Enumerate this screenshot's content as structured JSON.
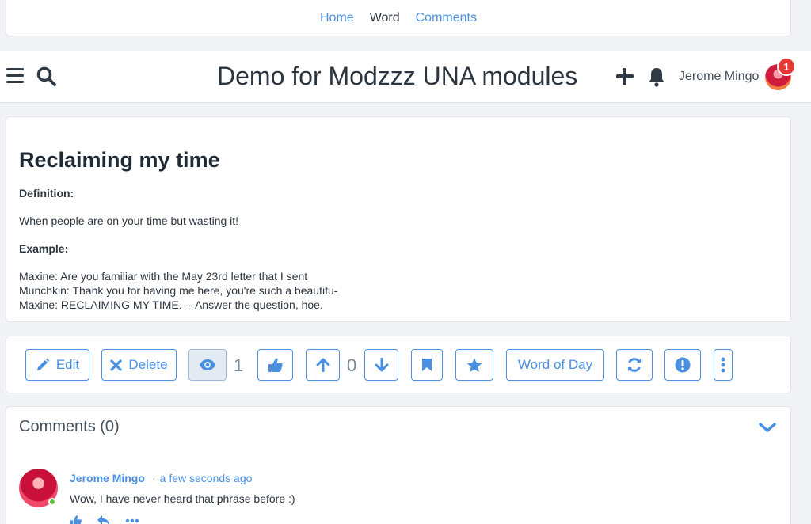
{
  "top_nav": {
    "items": [
      "Home",
      "Word",
      "Comments"
    ]
  },
  "header": {
    "site_title": "Demo for Modzzz UNA modules",
    "user_name": "Jerome Mingo",
    "notification_count": "1"
  },
  "word": {
    "title": "Reclaiming my time",
    "definition_label": "Definition:",
    "definition": "When people are on your time but wasting it!",
    "example_label": "Example:",
    "example_lines": [
      "Maxine: Are you familiar with the May 23rd letter that I sent",
      "Munchkin: Thank you for having me here, you're such a beautifu-",
      "Maxine: RECLAIMING MY TIME. -- Answer the question, hoe."
    ]
  },
  "actions": {
    "edit_label": "Edit",
    "delete_label": "Delete",
    "views_count": "1",
    "votes_count": "0",
    "word_of_day_label": "Word of Day"
  },
  "comments": {
    "title": "Comments (0)",
    "items": [
      {
        "author": "Jerome Mingo",
        "time": "a few seconds ago",
        "text": "Wow, I have never heard that phrase before :)"
      }
    ]
  },
  "colors": {
    "accent": "#4a90e2",
    "badge": "#e53935",
    "online": "#5cc43a"
  },
  "icons": [
    "menu-icon",
    "search-icon",
    "plus-icon",
    "bell-icon",
    "pencil-icon",
    "close-icon",
    "eye-icon",
    "thumbs-up-icon",
    "arrow-up-icon",
    "arrow-down-icon",
    "bookmark-icon",
    "star-icon",
    "refresh-icon",
    "exclamation-icon",
    "ellipsis-vertical-icon",
    "chevron-down-icon",
    "reply-icon",
    "ellipsis-icon"
  ]
}
